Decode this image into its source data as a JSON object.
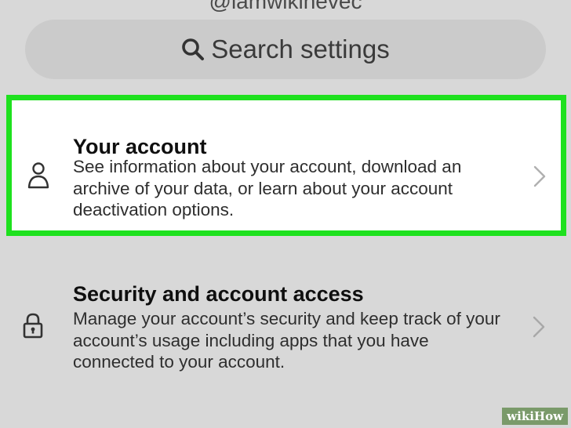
{
  "header": {
    "username": "@iamwikihevec"
  },
  "search": {
    "placeholder": "Search settings"
  },
  "settings_items": [
    {
      "icon": "person-icon",
      "title": "Your account",
      "description": "See information about your account, download an archive of your data, or learn about your account deactivation options.",
      "highlighted": true
    },
    {
      "icon": "lock-icon",
      "title": "Security and account access",
      "description": "Manage your account’s security and keep track of your account’s usage including apps that you have connected to your account.",
      "highlighted": false
    }
  ],
  "watermark": {
    "prefix": "wiki",
    "suffix": "How"
  },
  "colors": {
    "background": "#d8d8d8",
    "search_bar": "#cbcbcb",
    "highlight_border": "#1ee11e",
    "highlight_fill": "#ffffff"
  }
}
